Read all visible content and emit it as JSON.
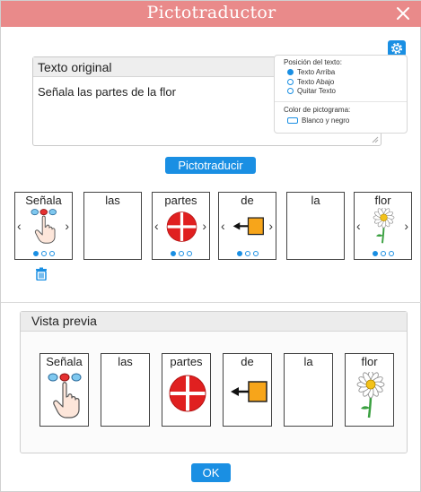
{
  "dialog": {
    "title": "Pictotraductor",
    "close_icon": "close-icon",
    "title_bar_color": "#e98a8a",
    "accent_color": "#1a8fe3"
  },
  "original": {
    "header": "Texto original",
    "text": "Señala las partes de la flor"
  },
  "options": {
    "position_title": "Posición del texto:",
    "position_options": [
      "Texto Arriba",
      "Texto Abajo",
      "Quitar Texto"
    ],
    "position_selected": "Texto Arriba",
    "color_title": "Color de pictograma:",
    "color_option": "Blanco y negro",
    "color_option_checked": false
  },
  "buttons": {
    "translate": "Pictotraducir",
    "ok": "OK"
  },
  "pictograms": [
    {
      "word": "Señala",
      "icon": "pointing-hand-icon",
      "has_arrows": true,
      "dots": 3,
      "active_dot": 0
    },
    {
      "word": "las",
      "icon": "",
      "has_arrows": false,
      "dots": 0,
      "active_dot": -1
    },
    {
      "word": "partes",
      "icon": "quartered-circle-icon",
      "has_arrows": true,
      "dots": 3,
      "active_dot": 0
    },
    {
      "word": "de",
      "icon": "arrow-from-square-icon",
      "has_arrows": true,
      "dots": 3,
      "active_dot": 0
    },
    {
      "word": "la",
      "icon": "",
      "has_arrows": false,
      "dots": 0,
      "active_dot": -1
    },
    {
      "word": "flor",
      "icon": "daisy-flower-icon",
      "has_arrows": true,
      "dots": 3,
      "active_dot": 0
    }
  ],
  "preview": {
    "header": "Vista previa",
    "cards": [
      {
        "word": "Señala",
        "icon": "pointing-hand-icon"
      },
      {
        "word": "las",
        "icon": ""
      },
      {
        "word": "partes",
        "icon": "quartered-circle-icon"
      },
      {
        "word": "de",
        "icon": "arrow-from-square-icon"
      },
      {
        "word": "la",
        "icon": ""
      },
      {
        "word": "flor",
        "icon": "daisy-flower-icon"
      }
    ]
  },
  "icons": {
    "settings": "gear-icon",
    "delete": "trash-icon"
  }
}
